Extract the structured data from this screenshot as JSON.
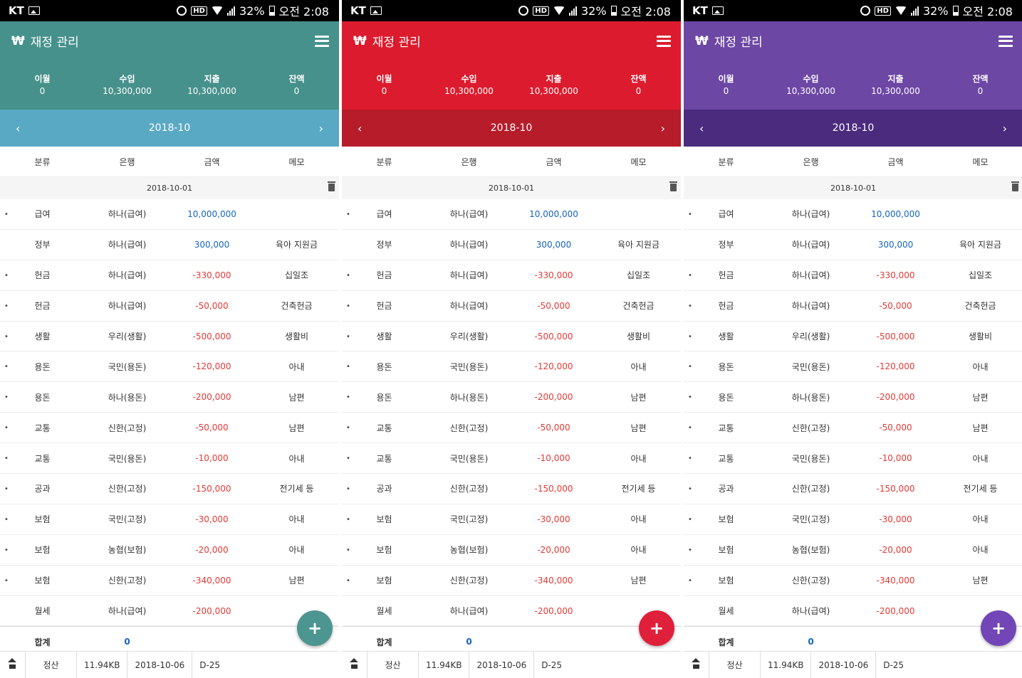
{
  "status": {
    "carrier": "KT",
    "battery": "32%",
    "time": "오전 2:08",
    "network": "G"
  },
  "app": {
    "title": "재정 관리",
    "currency_symbol": "₩"
  },
  "summary": {
    "carryover_label": "이월",
    "carryover_value": "0",
    "income_label": "수입",
    "income_value": "10,300,000",
    "expense_label": "지출",
    "expense_value": "10,300,000",
    "balance_label": "잔액",
    "balance_value": "0"
  },
  "month": {
    "current": "2018-10",
    "prev": "‹",
    "next": "›"
  },
  "columns": [
    "분류",
    "은행",
    "금액",
    "메모"
  ],
  "date_group": "2018-10-01",
  "transactions": [
    {
      "category": "급여",
      "bank": "하나(급여)",
      "amount": "10,000,000",
      "memo": "",
      "type": "pos",
      "bullet": true
    },
    {
      "category": "정부",
      "bank": "하나(급여)",
      "amount": "300,000",
      "memo": "육아 지원금",
      "type": "pos",
      "bullet": false
    },
    {
      "category": "헌금",
      "bank": "하나(급여)",
      "amount": "-330,000",
      "memo": "십일조",
      "type": "neg",
      "bullet": true
    },
    {
      "category": "헌금",
      "bank": "하나(급여)",
      "amount": "-50,000",
      "memo": "건축헌금",
      "type": "neg",
      "bullet": true
    },
    {
      "category": "생활",
      "bank": "우리(생활)",
      "amount": "-500,000",
      "memo": "생활비",
      "type": "neg",
      "bullet": true
    },
    {
      "category": "용돈",
      "bank": "국민(용돈)",
      "amount": "-120,000",
      "memo": "아내",
      "type": "neg",
      "bullet": true
    },
    {
      "category": "용돈",
      "bank": "하나(용돈)",
      "amount": "-200,000",
      "memo": "남편",
      "type": "neg",
      "bullet": true
    },
    {
      "category": "교통",
      "bank": "신한(고정)",
      "amount": "-50,000",
      "memo": "남편",
      "type": "neg",
      "bullet": true
    },
    {
      "category": "교통",
      "bank": "국민(용돈)",
      "amount": "-10,000",
      "memo": "아내",
      "type": "neg",
      "bullet": true
    },
    {
      "category": "공과",
      "bank": "신한(고정)",
      "amount": "-150,000",
      "memo": "전기세 등",
      "type": "neg",
      "bullet": true
    },
    {
      "category": "보험",
      "bank": "국민(고정)",
      "amount": "-30,000",
      "memo": "아내",
      "type": "neg",
      "bullet": true
    },
    {
      "category": "보험",
      "bank": "농협(보험)",
      "amount": "-20,000",
      "memo": "아내",
      "type": "neg",
      "bullet": true
    },
    {
      "category": "보험",
      "bank": "신한(고정)",
      "amount": "-340,000",
      "memo": "남편",
      "type": "neg",
      "bullet": true
    },
    {
      "category": "월세",
      "bank": "하나(급여)",
      "amount": "-200,000",
      "memo": "",
      "type": "neg",
      "bullet": false
    }
  ],
  "total": {
    "label": "합계",
    "value": "0"
  },
  "fab_label": "+",
  "footer": {
    "settle_label": "정산",
    "size": "11.94KB",
    "date": "2018-10-06",
    "dday": "D-25"
  },
  "themes": [
    {
      "name": "teal",
      "appbar": "#46918b",
      "nav": "#59a9c4",
      "fab": "#4d9590"
    },
    {
      "name": "red",
      "appbar": "#dc1c2e",
      "nav": "#b71c2a",
      "fab": "#e0203a"
    },
    {
      "name": "purple",
      "appbar": "#6d47a4",
      "nav": "#4a2b7e",
      "fab": "#7246b7"
    }
  ]
}
